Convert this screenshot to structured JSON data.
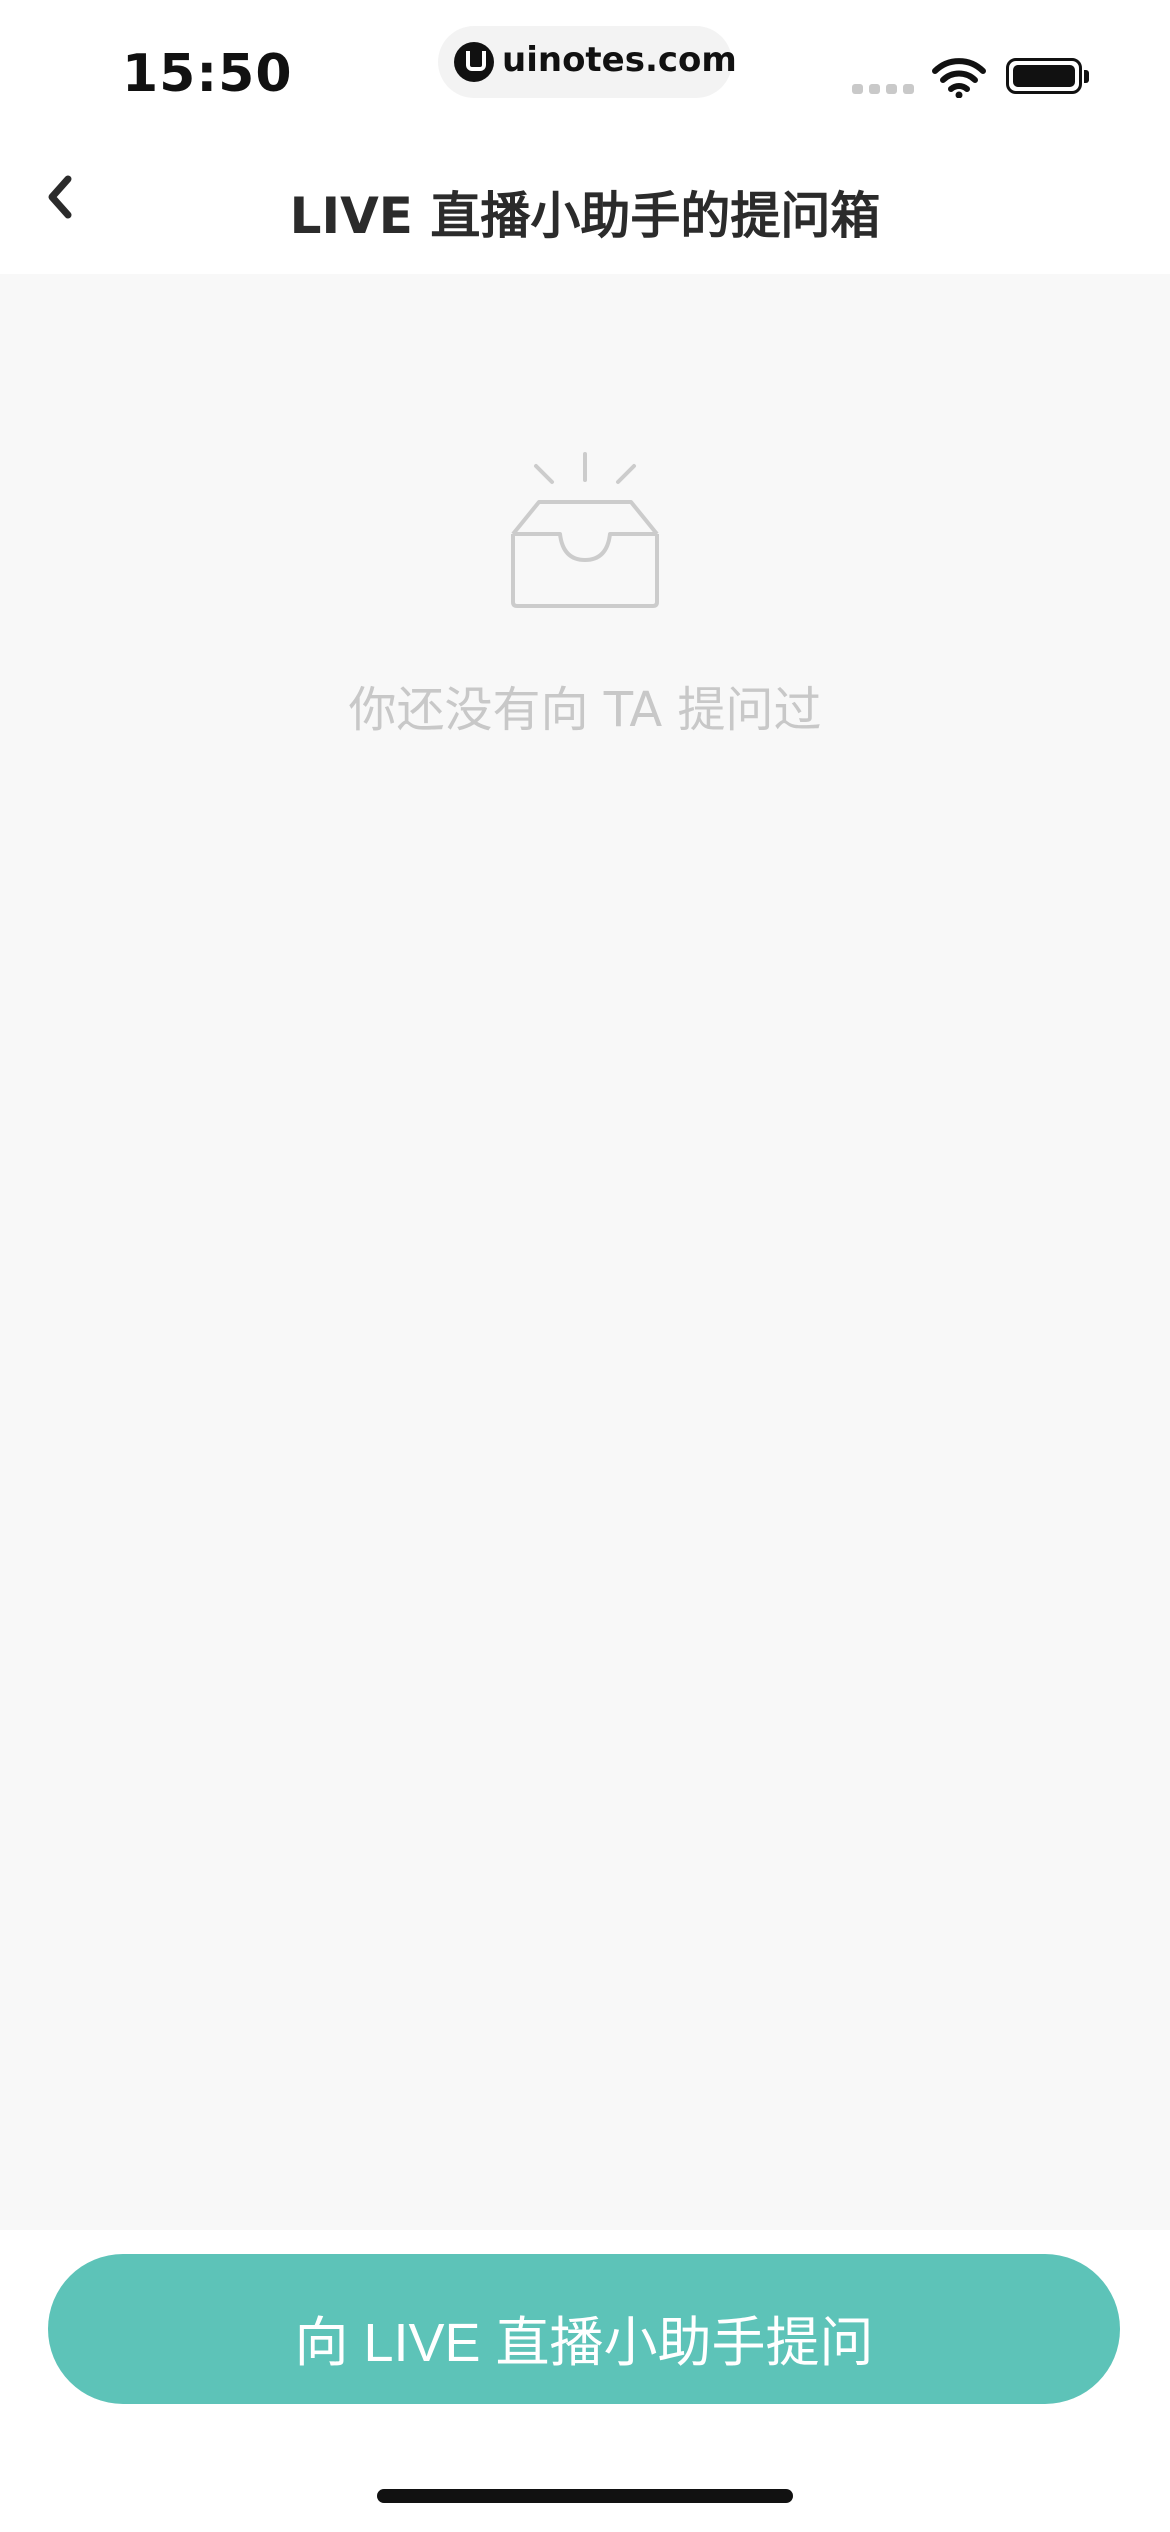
{
  "status_bar": {
    "time": "15:50",
    "url": "uinotes.com",
    "icons": [
      "signal-icon",
      "wifi-icon",
      "battery-icon"
    ]
  },
  "nav": {
    "back_icon": "chevron-left-icon",
    "title": "LIVE 直播小助手的提问箱"
  },
  "empty_state": {
    "icon": "inbox-icon",
    "message": "你还没有向 TA 提问过"
  },
  "footer": {
    "ask_button_label": "向 LIVE 直播小助手提问"
  },
  "colors": {
    "accent": "#5dc3b8",
    "content_background": "#f8f8f8",
    "muted_text": "#c8c8c8",
    "title_text": "#2b2b2b"
  }
}
